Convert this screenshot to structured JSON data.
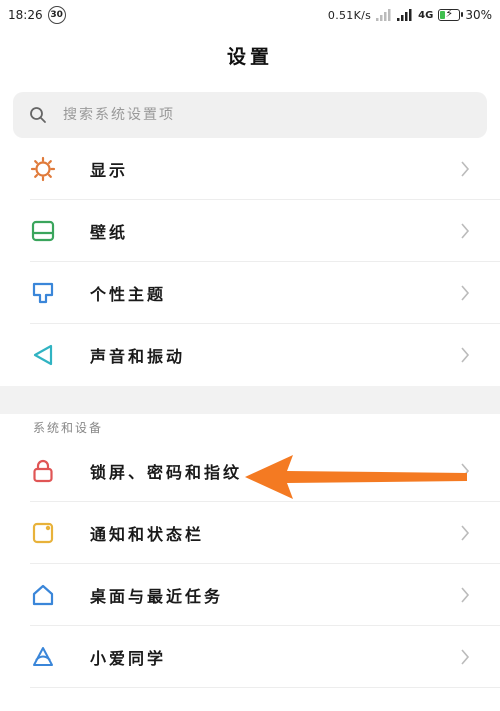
{
  "status_bar": {
    "time": "18:26",
    "badge": "30",
    "net_speed": "0.51K/s",
    "network": "4G",
    "battery_level_percent": 30,
    "battery": "30%"
  },
  "header": {
    "title": "设置"
  },
  "search": {
    "placeholder": "搜索系统设置项"
  },
  "groups": [
    {
      "items": [
        {
          "label": "显示",
          "icon": "display-icon",
          "color": "#e07a3a"
        },
        {
          "label": "壁纸",
          "icon": "wallpaper-icon",
          "color": "#3aa55c"
        },
        {
          "label": "个性主题",
          "icon": "theme-icon",
          "color": "#3a86d9"
        },
        {
          "label": "声音和振动",
          "icon": "sound-icon",
          "color": "#30b3c2"
        }
      ]
    },
    {
      "header": "系统和设备",
      "items": [
        {
          "label": "锁屏、密码和指纹",
          "icon": "lock-icon",
          "color": "#e05555"
        },
        {
          "label": "通知和状态栏",
          "icon": "notification-icon",
          "color": "#e8b23a"
        },
        {
          "label": "桌面与最近任务",
          "icon": "home-icon",
          "color": "#3a86d9"
        },
        {
          "label": "小爱同学",
          "icon": "xiaoai-icon",
          "color": "#3a86d9"
        }
      ]
    }
  ],
  "annotation": {
    "arrow_color": "#f47a22",
    "points_to": "锁屏、密码和指纹"
  }
}
